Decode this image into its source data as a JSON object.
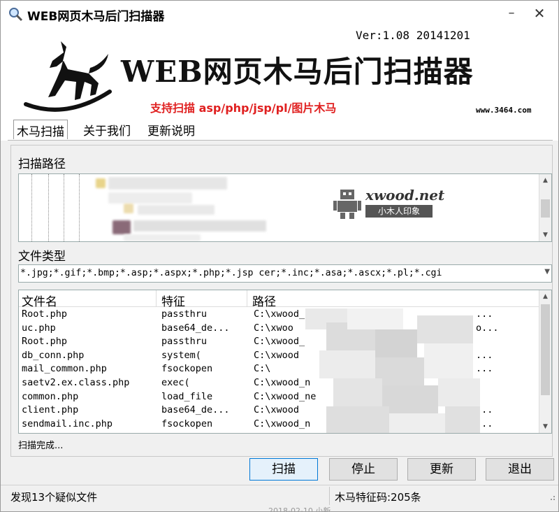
{
  "window": {
    "title": "WEB网页木马后门扫描器",
    "minimize_glyph": "–",
    "close_glyph": "✕"
  },
  "banner": {
    "version": "Ver:1.08 20141201",
    "title": "WEB网页木马后门扫描器",
    "support": "支持扫描 asp/php/jsp/pl/图片木马",
    "site": "www.3464.com",
    "accent_color": "#e02020"
  },
  "tabs": [
    "木马扫描",
    "关于我们",
    "更新说明"
  ],
  "scan_path": {
    "label": "扫描路径"
  },
  "watermark": {
    "name": "xwood.net",
    "tag": "小木人印象"
  },
  "file_type": {
    "label": "文件类型",
    "value": "*.jpg;*.gif;*.bmp;*.asp;*.aspx;*.php;*.jsp  cer;*.inc;*.asa;*.ascx;*.pl;*.cgi"
  },
  "results": {
    "columns": [
      "文件名",
      "特征",
      "路径"
    ],
    "rows": [
      {
        "file": "Root.php",
        "feature": "passthru",
        "path": "C:\\xwood_ne",
        "tail": "..."
      },
      {
        "file": "uc.php",
        "feature": "base64_de...",
        "path": "C:\\xwoo",
        "tail": "o..."
      },
      {
        "file": "Root.php",
        "feature": "passthru",
        "path": "C:\\xwood_",
        "tail": ""
      },
      {
        "file": "db_conn.php",
        "feature": "system(",
        "path": "C:\\xwood",
        "tail": "..."
      },
      {
        "file": "mail_common.php",
        "feature": "fsockopen",
        "path": "C:\\",
        "tail": "..."
      },
      {
        "file": "saetv2.ex.class.php",
        "feature": "exec(",
        "path": "C:\\xwood_n",
        "tail": ""
      },
      {
        "file": "common.php",
        "feature": "load_file",
        "path": "C:\\xwood_ne",
        "tail": ""
      },
      {
        "file": "client.php",
        "feature": "base64_de...",
        "path": "C:\\xwood",
        "tail": "..."
      },
      {
        "file": "sendmail.inc.php",
        "feature": "fsockopen",
        "path": "C:\\xwood_n",
        "tail": "..."
      }
    ],
    "status": "扫描完成..."
  },
  "buttons": {
    "scan": "扫描",
    "stop": "停止",
    "update": "更新",
    "exit": "退出"
  },
  "statusbar": {
    "found": "发现13个疑似文件",
    "signatures": "木马特征码:205条"
  },
  "below_text": "2018-02-10 小新"
}
